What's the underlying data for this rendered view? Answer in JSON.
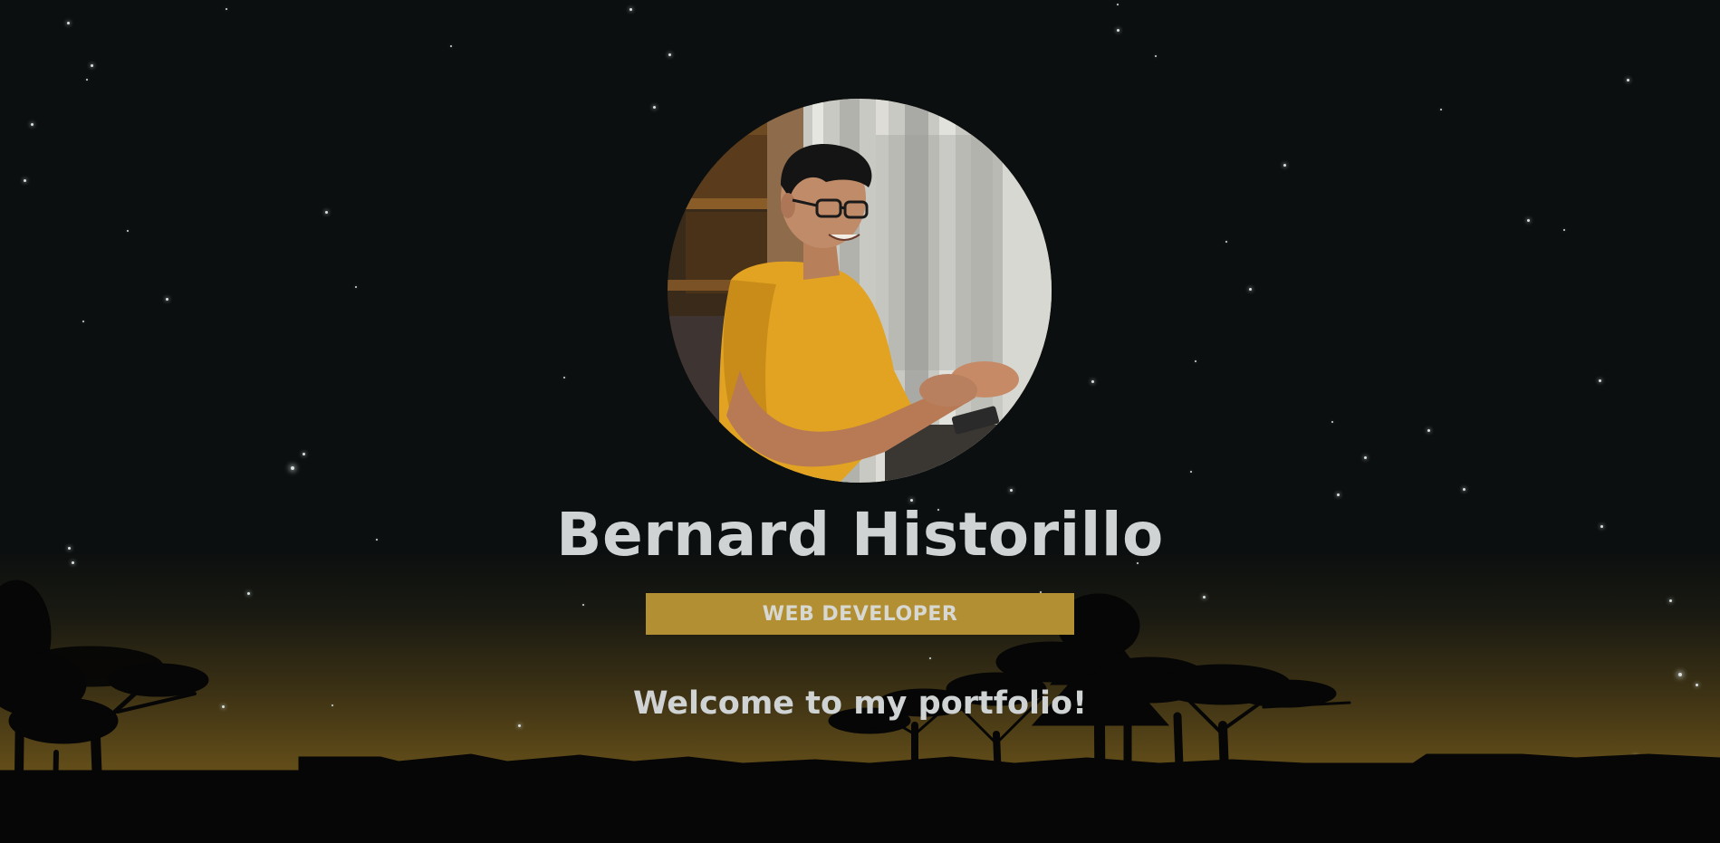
{
  "hero": {
    "name": "Bernard Historillo",
    "role": "WEB DEVELOPER",
    "welcome": "Welcome to my portfolio!"
  },
  "icons": {
    "profile_photo": "profile-photo",
    "background": "night-sky-landscape"
  },
  "colors": {
    "background": "#0c0f0f",
    "horizon_glow": "#6a531a",
    "badge": "#b38f34",
    "text": "#cfd3d3"
  }
}
